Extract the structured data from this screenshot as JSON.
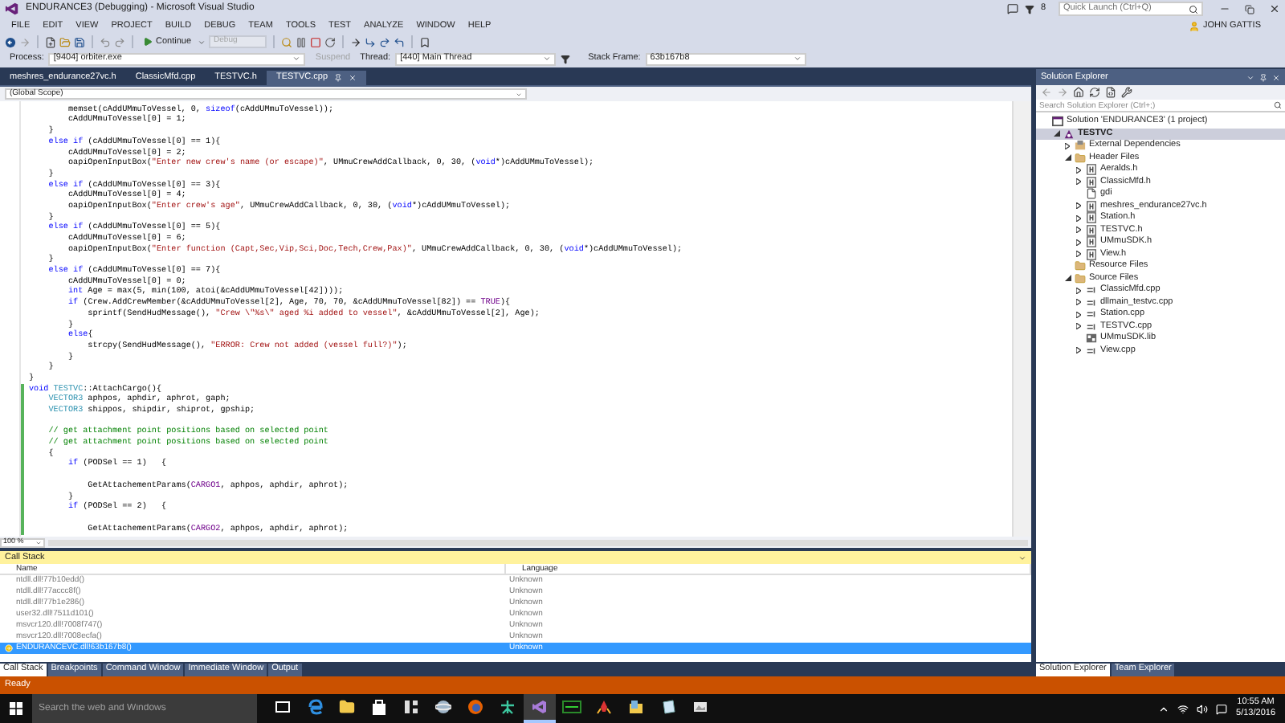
{
  "window": {
    "title": "ENDURANCE3 (Debugging) - Microsoft Visual Studio",
    "notification_count": "8",
    "quick_launch": {
      "placeholder": "Quick Launch (Ctrl+Q)"
    }
  },
  "menu": {
    "items": [
      "FILE",
      "EDIT",
      "VIEW",
      "PROJECT",
      "BUILD",
      "DEBUG",
      "TEAM",
      "TOOLS",
      "TEST",
      "ANALYZE",
      "WINDOW",
      "HELP"
    ],
    "user": "JOHN GATTIS"
  },
  "toolbar": {
    "continue": "Continue",
    "config": {
      "value": "Debug",
      "disabled": true
    }
  },
  "debug_location": {
    "process_label": "Process:",
    "process": "[9404] orbiter.exe",
    "suspend": {
      "label": "Suspend",
      "disabled": true
    },
    "thread_label": "Thread:",
    "thread": "[440] Main Thread",
    "stack_frame_label": "Stack Frame:",
    "stack_frame": "63b167b8"
  },
  "document_tabs": [
    {
      "label": "meshres_endurance27vc.h",
      "selected": false
    },
    {
      "label": "ClassicMfd.cpp",
      "selected": false
    },
    {
      "label": "TESTVC.h",
      "selected": false
    },
    {
      "label": "TESTVC.cpp",
      "selected": true
    }
  ],
  "editor": {
    "scope": "(Global Scope)",
    "zoom": "100 %",
    "lines": [
      {
        "changed": false,
        "segs": [
          {
            "kind": "plain",
            "text": "        memset(cAddUMmuToVessel, 0, "
          },
          {
            "kind": "keyword",
            "text": "sizeof"
          },
          {
            "kind": "plain",
            "text": "(cAddUMmuToVessel));"
          }
        ]
      },
      {
        "changed": false,
        "segs": [
          {
            "kind": "plain",
            "text": "        cAddUMmuToVessel[0] = 1;"
          }
        ]
      },
      {
        "changed": false,
        "segs": [
          {
            "kind": "plain",
            "text": "    }"
          }
        ]
      },
      {
        "changed": false,
        "segs": [
          {
            "kind": "keyword",
            "text": "    else if"
          },
          {
            "kind": "plain",
            "text": " (cAddUMmuToVessel[0] == 1){"
          }
        ]
      },
      {
        "changed": false,
        "segs": [
          {
            "kind": "plain",
            "text": "        cAddUMmuToVessel[0] = 2;"
          }
        ]
      },
      {
        "changed": false,
        "segs": [
          {
            "kind": "plain",
            "text": "        oapiOpenInputBox("
          },
          {
            "kind": "string",
            "text": "\"Enter new crew's name (or escape)\""
          },
          {
            "kind": "plain",
            "text": ", UMmuCrewAddCallback, 0, 30, ("
          },
          {
            "kind": "keyword",
            "text": "void"
          },
          {
            "kind": "plain",
            "text": "*)cAddUMmuToVessel);"
          }
        ]
      },
      {
        "changed": false,
        "segs": [
          {
            "kind": "plain",
            "text": "    }"
          }
        ]
      },
      {
        "changed": false,
        "segs": [
          {
            "kind": "keyword",
            "text": "    else if"
          },
          {
            "kind": "plain",
            "text": " (cAddUMmuToVessel[0] == 3){"
          }
        ]
      },
      {
        "changed": false,
        "segs": [
          {
            "kind": "plain",
            "text": "        cAddUMmuToVessel[0] = 4;"
          }
        ]
      },
      {
        "changed": false,
        "segs": [
          {
            "kind": "plain",
            "text": "        oapiOpenInputBox("
          },
          {
            "kind": "string",
            "text": "\"Enter crew's age\""
          },
          {
            "kind": "plain",
            "text": ", UMmuCrewAddCallback, 0, 30, ("
          },
          {
            "kind": "keyword",
            "text": "void"
          },
          {
            "kind": "plain",
            "text": "*)cAddUMmuToVessel);"
          }
        ]
      },
      {
        "changed": false,
        "segs": [
          {
            "kind": "plain",
            "text": "    }"
          }
        ]
      },
      {
        "changed": false,
        "segs": [
          {
            "kind": "keyword",
            "text": "    else if"
          },
          {
            "kind": "plain",
            "text": " (cAddUMmuToVessel[0] == 5){"
          }
        ]
      },
      {
        "changed": false,
        "segs": [
          {
            "kind": "plain",
            "text": "        cAddUMmuToVessel[0] = 6;"
          }
        ]
      },
      {
        "changed": false,
        "segs": [
          {
            "kind": "plain",
            "text": "        oapiOpenInputBox("
          },
          {
            "kind": "string",
            "text": "\"Enter function (Capt,Sec,Vip,Sci,Doc,Tech,Crew,Pax)\""
          },
          {
            "kind": "plain",
            "text": ", UMmuCrewAddCallback, 0, 30, ("
          },
          {
            "kind": "keyword",
            "text": "void"
          },
          {
            "kind": "plain",
            "text": "*)cAddUMmuToVessel);"
          }
        ]
      },
      {
        "changed": false,
        "segs": [
          {
            "kind": "plain",
            "text": "    }"
          }
        ]
      },
      {
        "changed": false,
        "segs": [
          {
            "kind": "keyword",
            "text": "    else if"
          },
          {
            "kind": "plain",
            "text": " (cAddUMmuToVessel[0] == 7){"
          }
        ]
      },
      {
        "changed": false,
        "segs": [
          {
            "kind": "plain",
            "text": "        cAddUMmuToVessel[0] = 0;"
          }
        ]
      },
      {
        "changed": false,
        "segs": [
          {
            "kind": "keyword",
            "text": "        int"
          },
          {
            "kind": "plain",
            "text": " Age = max(5, min(100, atoi(&cAddUMmuToVessel[42])));"
          }
        ]
      },
      {
        "changed": false,
        "segs": [
          {
            "kind": "keyword",
            "text": "        if"
          },
          {
            "kind": "plain",
            "text": " (Crew.AddCrewMember(&cAddUMmuToVessel[2], Age, 70, 70, &cAddUMmuToVessel[82]) == "
          },
          {
            "kind": "macro",
            "text": "TRUE"
          },
          {
            "kind": "plain",
            "text": "){"
          }
        ]
      },
      {
        "changed": false,
        "segs": [
          {
            "kind": "plain",
            "text": "            sprintf(SendHudMessage(), "
          },
          {
            "kind": "string",
            "text": "\"Crew \\\"%s\\\" aged %i added to vessel\""
          },
          {
            "kind": "plain",
            "text": ", &cAddUMmuToVessel[2], Age);"
          }
        ]
      },
      {
        "changed": false,
        "segs": [
          {
            "kind": "plain",
            "text": "        }"
          }
        ]
      },
      {
        "changed": false,
        "segs": [
          {
            "kind": "keyword",
            "text": "        else"
          },
          {
            "kind": "plain",
            "text": "{"
          }
        ]
      },
      {
        "changed": false,
        "segs": [
          {
            "kind": "plain",
            "text": "            strcpy(SendHudMessage(), "
          },
          {
            "kind": "string",
            "text": "\"ERROR: Crew not added (vessel full?)\""
          },
          {
            "kind": "plain",
            "text": ");"
          }
        ]
      },
      {
        "changed": false,
        "segs": [
          {
            "kind": "plain",
            "text": "        }"
          }
        ]
      },
      {
        "changed": false,
        "segs": [
          {
            "kind": "plain",
            "text": "    }"
          }
        ]
      },
      {
        "changed": false,
        "segs": [
          {
            "kind": "plain",
            "text": "}"
          }
        ]
      },
      {
        "changed": true,
        "segs": [
          {
            "kind": "keyword",
            "text": "void"
          },
          {
            "kind": "type",
            "text": " TESTVC"
          },
          {
            "kind": "plain",
            "text": "::AttachCargo(){"
          }
        ]
      },
      {
        "changed": true,
        "segs": [
          {
            "kind": "type",
            "text": "    VECTOR3"
          },
          {
            "kind": "plain",
            "text": " aphpos, aphdir, aphrot, gaph;"
          }
        ]
      },
      {
        "changed": true,
        "segs": [
          {
            "kind": "type",
            "text": "    VECTOR3"
          },
          {
            "kind": "plain",
            "text": " shippos, shipdir, shiprot, gpship;"
          }
        ]
      },
      {
        "changed": true
      },
      {
        "changed": true,
        "segs": [
          {
            "kind": "comment",
            "text": "    // get attachment point positions based on selected point"
          }
        ]
      },
      {
        "changed": true,
        "segs": [
          {
            "kind": "comment",
            "text": "    // get attachment point positions based on selected point"
          }
        ]
      },
      {
        "changed": true,
        "segs": [
          {
            "kind": "plain",
            "text": "    {"
          }
        ]
      },
      {
        "changed": true,
        "segs": [
          {
            "kind": "keyword",
            "text": "        if"
          },
          {
            "kind": "plain",
            "text": " (PODSel == 1)   {"
          }
        ]
      },
      {
        "changed": true
      },
      {
        "changed": true,
        "segs": [
          {
            "kind": "plain",
            "text": "            GetAttachementParams("
          },
          {
            "kind": "macro",
            "text": "CARGO1"
          },
          {
            "kind": "plain",
            "text": ", aphpos, aphdir, aphrot);"
          }
        ]
      },
      {
        "changed": true,
        "segs": [
          {
            "kind": "plain",
            "text": "        }"
          }
        ]
      },
      {
        "changed": true,
        "segs": [
          {
            "kind": "keyword",
            "text": "        if"
          },
          {
            "kind": "plain",
            "text": " (PODSel == 2)   {"
          }
        ]
      },
      {
        "changed": true
      },
      {
        "changed": true,
        "segs": [
          {
            "kind": "plain",
            "text": "            GetAttachementParams("
          },
          {
            "kind": "macro",
            "text": "CARGO2"
          },
          {
            "kind": "plain",
            "text": ", aphpos, aphdir, aphrot);"
          }
        ]
      }
    ]
  },
  "call_stack": {
    "title": "Call Stack",
    "columns": [
      "Name",
      "Language"
    ],
    "rows": [
      {
        "name": "ntdll.dll!77b10edd()",
        "language": "Unknown",
        "selected": false,
        "current": false
      },
      {
        "name": "ntdll.dll!77accc8f()",
        "language": "Unknown",
        "selected": false,
        "current": false
      },
      {
        "name": "ntdll.dll!77b1e286()",
        "language": "Unknown",
        "selected": false,
        "current": false
      },
      {
        "name": "user32.dll!7511d101()",
        "language": "Unknown",
        "selected": false,
        "current": false
      },
      {
        "name": "msvcr120.dll!7008f747()",
        "language": "Unknown",
        "selected": false,
        "current": false
      },
      {
        "name": "msvcr120.dll!7008ecfa()",
        "language": "Unknown",
        "selected": false,
        "current": false
      },
      {
        "name": "ENDURANCEVC.dll!63b167b8()",
        "language": "Unknown",
        "selected": true,
        "current": true
      }
    ]
  },
  "bottom_tabs": [
    {
      "label": "Call Stack",
      "selected": true
    },
    {
      "label": "Breakpoints",
      "selected": false
    },
    {
      "label": "Command Window",
      "selected": false
    },
    {
      "label": "Immediate Window",
      "selected": false
    },
    {
      "label": "Output",
      "selected": false
    }
  ],
  "solution_explorer": {
    "title": "Solution Explorer",
    "search": {
      "placeholder": "Search Solution Explorer (Ctrl+;)"
    },
    "tree": [
      {
        "label": "Solution 'ENDURANCE3' (1 project)",
        "kind": "solution",
        "selected": false,
        "children": [
          {
            "label": "TESTVC",
            "kind": "project",
            "expanded": true,
            "selected": true,
            "children": [
              {
                "label": "External Dependencies",
                "kind": "dependencies",
                "expanded": false,
                "selected": false
              },
              {
                "label": "Header Files",
                "kind": "folder",
                "expanded": true,
                "selected": false,
                "children": [
                  {
                    "label": "Aeralds.h",
                    "kind": "header",
                    "expanded": false,
                    "selected": false
                  },
                  {
                    "label": "ClassicMfd.h",
                    "kind": "header",
                    "expanded": false,
                    "selected": false
                  },
                  {
                    "label": "gdi",
                    "kind": "file",
                    "selected": false
                  },
                  {
                    "label": "meshres_endurance27vc.h",
                    "kind": "header",
                    "expanded": false,
                    "selected": false
                  },
                  {
                    "label": "Station.h",
                    "kind": "header",
                    "expanded": false,
                    "selected": false
                  },
                  {
                    "label": "TESTVC.h",
                    "kind": "header",
                    "expanded": false,
                    "selected": false
                  },
                  {
                    "label": "UMmuSDK.h",
                    "kind": "header",
                    "expanded": false,
                    "selected": false
                  },
                  {
                    "label": "View.h",
                    "kind": "header",
                    "expanded": false,
                    "selected": false
                  }
                ]
              },
              {
                "label": "Resource Files",
                "kind": "folder",
                "selected": false
              },
              {
                "label": "Source Files",
                "kind": "folder",
                "expanded": true,
                "selected": false,
                "children": [
                  {
                    "label": "ClassicMfd.cpp",
                    "kind": "source",
                    "expanded": false,
                    "selected": false
                  },
                  {
                    "label": "dllmain_testvc.cpp",
                    "kind": "source",
                    "expanded": false,
                    "selected": false
                  },
                  {
                    "label": "Station.cpp",
                    "kind": "source",
                    "expanded": false,
                    "selected": false
                  },
                  {
                    "label": "TESTVC.cpp",
                    "kind": "source",
                    "expanded": false,
                    "selected": false
                  },
                  {
                    "label": "UMmuSDK.lib",
                    "kind": "library",
                    "selected": false
                  },
                  {
                    "label": "View.cpp",
                    "kind": "source",
                    "expanded": false,
                    "selected": false
                  }
                ]
              }
            ]
          }
        ]
      }
    ],
    "tabs": [
      {
        "label": "Solution Explorer",
        "selected": true
      },
      {
        "label": "Team Explorer",
        "selected": false
      }
    ]
  },
  "status_bar": {
    "text": "Ready"
  },
  "taskbar": {
    "search": {
      "placeholder": "Search the web and Windows"
    },
    "apps": [
      {
        "kind": "task-view",
        "selected": false
      },
      {
        "kind": "edge",
        "selected": false
      },
      {
        "kind": "folder",
        "selected": false
      },
      {
        "kind": "store",
        "selected": false
      },
      {
        "kind": "panels",
        "selected": false
      },
      {
        "kind": "globe",
        "selected": false
      },
      {
        "kind": "firefox",
        "selected": false
      },
      {
        "kind": "figure",
        "selected": false
      },
      {
        "kind": "vs",
        "selected": true
      },
      {
        "kind": "terminal",
        "selected": false
      },
      {
        "kind": "rocket",
        "selected": false
      },
      {
        "kind": "picture-folder",
        "selected": false
      },
      {
        "kind": "notebook",
        "selected": false
      },
      {
        "kind": "photos",
        "selected": false
      }
    ],
    "time": "10:55 AM",
    "date": "5/13/2016"
  }
}
